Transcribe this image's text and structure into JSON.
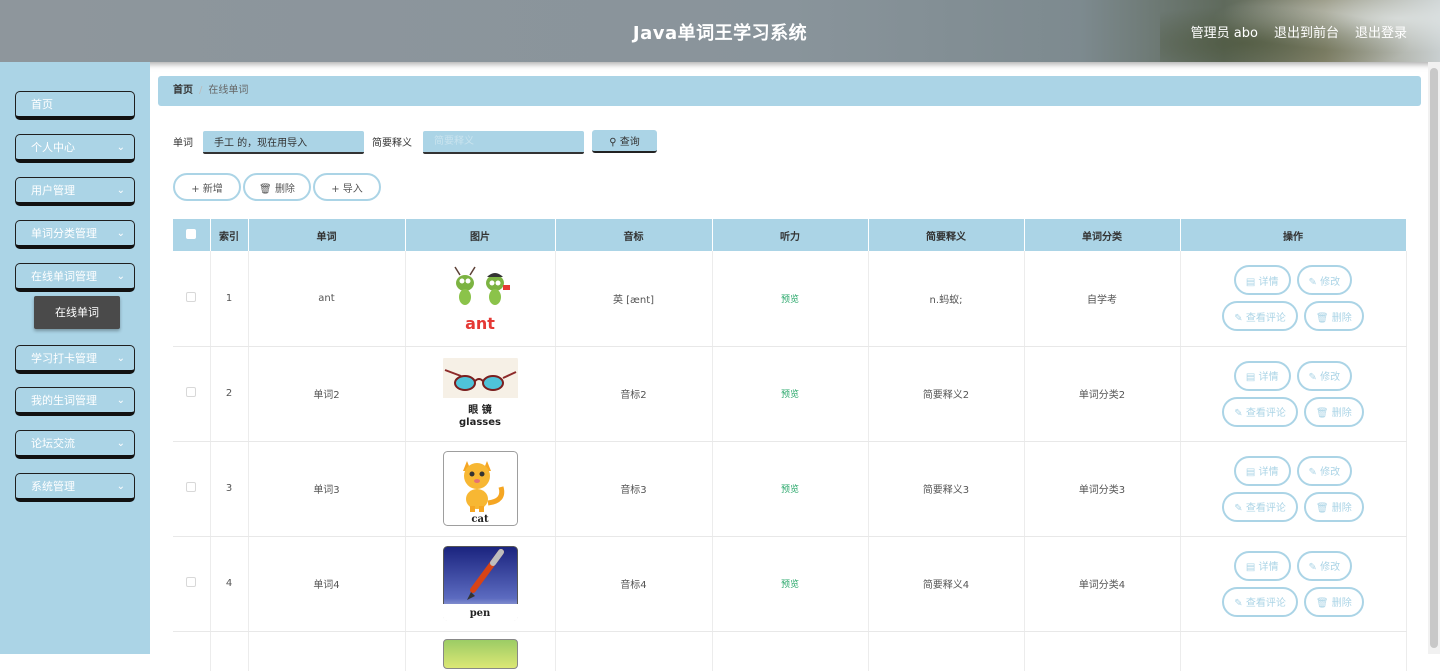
{
  "header": {
    "title": "Java单词王学习系统",
    "user": "管理员 abo",
    "to_front": "退出到前台",
    "logout": "退出登录"
  },
  "sidebar": {
    "items": [
      {
        "label": "首页",
        "has_children": false
      },
      {
        "label": "个人中心",
        "has_children": true
      },
      {
        "label": "用户管理",
        "has_children": true
      },
      {
        "label": "单词分类管理",
        "has_children": true
      },
      {
        "label": "在线单词管理",
        "has_children": true
      },
      {
        "label": "学习打卡管理",
        "has_children": true
      },
      {
        "label": "我的生词管理",
        "has_children": true
      },
      {
        "label": "论坛交流",
        "has_children": true
      },
      {
        "label": "系统管理",
        "has_children": true
      }
    ],
    "active_sub": "在线单词"
  },
  "breadcrumb": {
    "home": "首页",
    "current": "在线单词",
    "sep": "/"
  },
  "search": {
    "word_label": "单词",
    "word_value": "手工 的，现在用导入",
    "def_label": "简要释义",
    "def_placeholder": "简要释义",
    "query_label": "查询"
  },
  "actions": {
    "add": "新增",
    "delete": "删除",
    "import": "导入"
  },
  "table": {
    "columns": [
      "索引",
      "单词",
      "图片",
      "音标",
      "听力",
      "简要释义",
      "单词分类",
      "操作"
    ],
    "rows": [
      {
        "index": "1",
        "word": "ant",
        "image": "ant",
        "image_caption": "ant",
        "phonetic": "英 [ænt]",
        "audio": "预览",
        "definition": "n.蚂蚁;",
        "category": "自学考"
      },
      {
        "index": "2",
        "word": "单词2",
        "image": "glasses",
        "image_caption": "glasses",
        "image_caption_cn": "眼 镜",
        "phonetic": "音标2",
        "audio": "预览",
        "definition": "简要释义2",
        "category": "单词分类2"
      },
      {
        "index": "3",
        "word": "单词3",
        "image": "cat",
        "image_caption": "cat",
        "phonetic": "音标3",
        "audio": "预览",
        "definition": "简要释义3",
        "category": "单词分类3"
      },
      {
        "index": "4",
        "word": "单词4",
        "image": "pen",
        "image_caption": "pen",
        "phonetic": "音标4",
        "audio": "预览",
        "definition": "简要释义4",
        "category": "单词分类4"
      }
    ],
    "ops": {
      "detail": "详情",
      "edit": "修改",
      "comments": "查看评论",
      "delete": "删除"
    }
  },
  "colors": {
    "accent": "#abd4e6",
    "preview": "#2aa86b",
    "active_sub": "#4a4a4a"
  }
}
